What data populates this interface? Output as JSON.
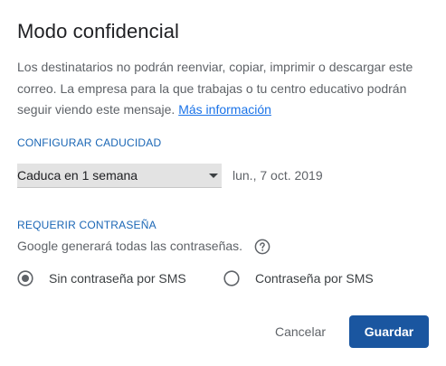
{
  "dialog": {
    "title": "Modo confidencial",
    "description": "Los destinatarios no podrán reenviar, copiar, imprimir o descargar este correo. La empresa para la que trabajas o tu centro educativo podrán seguir viendo este mensaje.",
    "more_info_link": "Más información"
  },
  "expiry": {
    "section_label": "CONFIGURAR CADUCIDAD",
    "selected_option": "Caduca en 1 semana",
    "date": "lun., 7 oct. 2019"
  },
  "password": {
    "section_label": "REQUERIR CONTRASEÑA",
    "note": "Google generará todas las contraseñas.",
    "options": [
      {
        "label": "Sin contraseña por SMS",
        "selected": true
      },
      {
        "label": "Contraseña por SMS",
        "selected": false
      }
    ]
  },
  "actions": {
    "cancel_label": "Cancelar",
    "save_label": "Guardar"
  },
  "colors": {
    "accent": "#1a56a0",
    "link": "#1a73e8",
    "section_label": "#1a66b5"
  },
  "icons": {
    "help": "help-circle-icon",
    "dropdown": "caret-down-icon"
  }
}
